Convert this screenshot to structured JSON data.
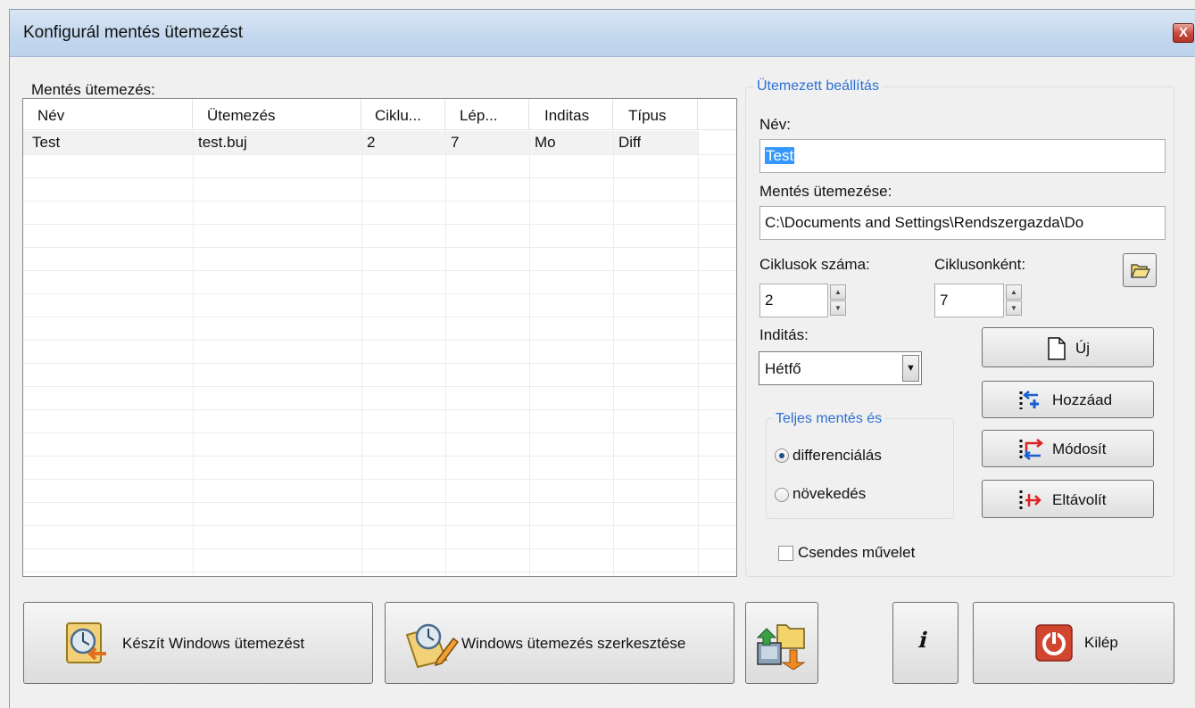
{
  "window": {
    "title": "Konfigurál mentés ütemezést",
    "close_label": "X"
  },
  "list": {
    "label": "Mentés ütemezés:",
    "columns": [
      "Név",
      "Ütemezés",
      "Ciklu...",
      "Lép...",
      "Inditas",
      "Típus"
    ],
    "rows": [
      {
        "nev": "Test",
        "utemezes": "test.buj",
        "ciklus": "2",
        "lepes": "7",
        "inditas": "Mo",
        "tipus": "Diff"
      }
    ]
  },
  "settings": {
    "group_title": "Ütemezett beállítás",
    "name_label": "Név:",
    "name_value": "Test",
    "schedule_label": "Mentés ütemezése:",
    "schedule_value": "C:\\Documents and Settings\\Rendszergazda\\Do",
    "cycles_label": "Ciklusok száma:",
    "cycles_value": "2",
    "per_cycle_label": "Ciklusonként:",
    "per_cycle_value": "7",
    "start_label": "Inditás:",
    "start_value": "Hétfő",
    "full_backup_title": "Teljes mentés és",
    "radio_diff": "differenciálás",
    "radio_incr": "növekedés",
    "radio_selected": "differenciálás",
    "quiet_label": "Csendes művelet",
    "quiet_checked": false
  },
  "actions": {
    "new": "Új",
    "add": "Hozzáad",
    "modify": "Módosít",
    "remove": "Eltávolít"
  },
  "bottom": {
    "create_task": "Készít Windows ütemezést",
    "edit_task": "Windows ütemezés szerkesztése",
    "exit": "Kilép",
    "info_glyph": "ℹ"
  },
  "colors": {
    "accent_blue": "#2d6fd3",
    "selection": "#3399ff",
    "exit_red": "#d2452e"
  }
}
